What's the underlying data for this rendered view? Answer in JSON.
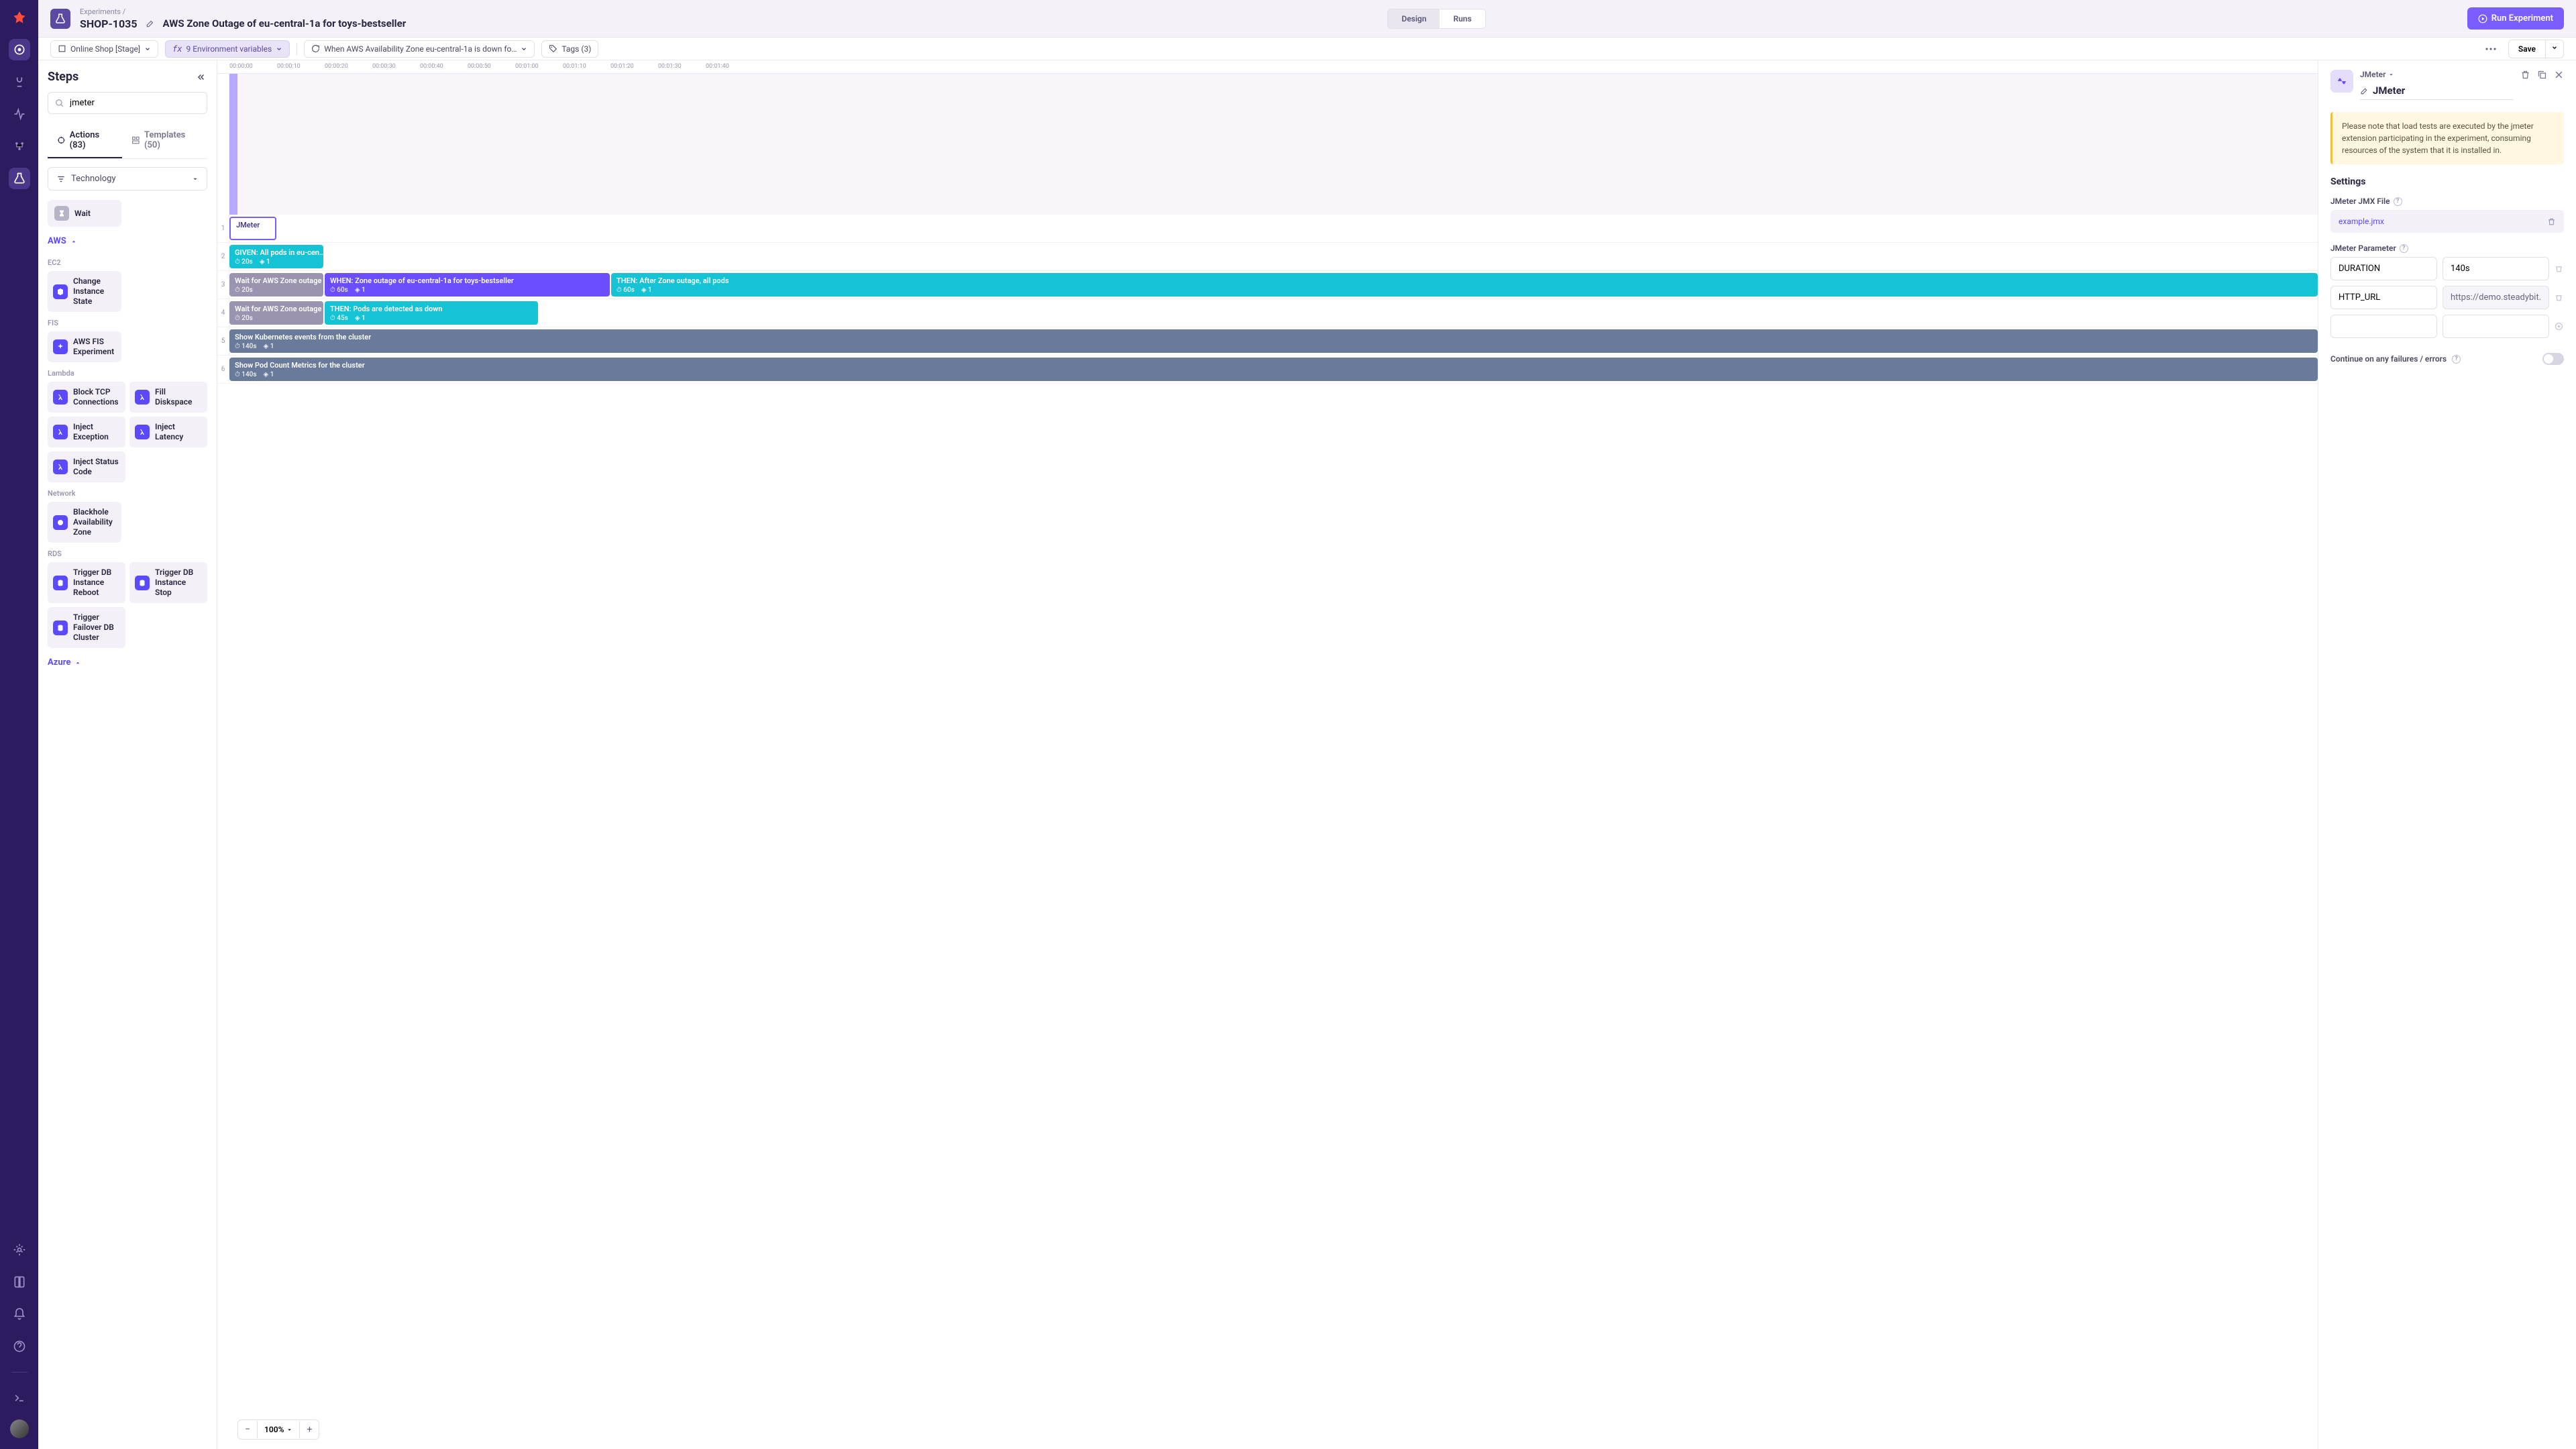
{
  "header": {
    "breadcrumb": "Experiments /",
    "code": "SHOP-1035",
    "title": "AWS Zone Outage of eu-central-1a for toys-bestseller",
    "tab_design": "Design",
    "tab_runs": "Runs",
    "run_button": "Run Experiment"
  },
  "toolbar": {
    "env": "Online Shop [Stage]",
    "vars": "9 Environment variables",
    "hypothesis": "When AWS Availability Zone eu-central-1a is down fo…",
    "tags": "Tags (3)",
    "save": "Save"
  },
  "sidebar": {
    "title": "Steps",
    "search_value": "jmeter",
    "tab_actions": "Actions (83)",
    "tab_templates": "Templates (50)",
    "tech_label": "Technology",
    "wait_label": "Wait",
    "cat_aws": "AWS",
    "sub_ec2": "EC2",
    "a_change_state": "Change Instance State",
    "sub_fis": "FIS",
    "a_fis": "AWS FIS Experiment",
    "sub_lambda": "Lambda",
    "a_block_tcp": "Block TCP Connections",
    "a_fill_disk": "Fill Diskspace",
    "a_inject_exc": "Inject Exception",
    "a_inject_lat": "Inject Latency",
    "a_inject_status": "Inject Status Code",
    "sub_network": "Network",
    "a_blackhole": "Blackhole Availability Zone",
    "sub_rds": "RDS",
    "a_db_reboot": "Trigger DB Instance Reboot",
    "a_db_stop": "Trigger DB Instance Stop",
    "a_failover": "Trigger Failover DB Cluster",
    "cat_azure": "Azure"
  },
  "ruler": [
    "00:00:00",
    "00:00:10",
    "00:00:20",
    "00:00:30",
    "00:00:40",
    "00:00:50",
    "00:01:00",
    "00:01:10",
    "00:01:20",
    "00:01:30",
    "00:01:40"
  ],
  "lanes": {
    "l1": {
      "jmeter": "JMeter"
    },
    "l2": {
      "given": "GIVEN: All pods in eu-cen…",
      "given_d": "20s",
      "given_t": "1"
    },
    "l3": {
      "wait": "Wait for AWS Zone outage",
      "wait_d": "20s",
      "when": "WHEN: Zone outage of eu-central-1a for toys-bestseller",
      "when_d": "60s",
      "when_t": "1",
      "then": "THEN: After Zone outage, all pods",
      "then_d": "60s",
      "then_t": "1"
    },
    "l4": {
      "wait": "Wait for AWS Zone outage",
      "wait_d": "20s",
      "then": "THEN: Pods are detected as down",
      "then_d": "45s",
      "then_t": "1"
    },
    "l5": {
      "title": "Show Kubernetes events from the cluster",
      "d": "140s",
      "t": "1"
    },
    "l6": {
      "title": "Show Pod Count Metrics for the cluster",
      "d": "140s",
      "t": "1"
    }
  },
  "zoom": "100%",
  "detail": {
    "crumb": "JMeter",
    "name": "JMeter",
    "note": "Please note that load tests are executed by the jmeter extension participating in the experiment, consuming resources of the system that it is installed in.",
    "settings": "Settings",
    "file_label": "JMeter JMX File",
    "file_name": "example.jmx",
    "param_label": "JMeter Parameter",
    "p1_k": "DURATION",
    "p1_v": "140s",
    "p2_k": "HTTP_URL",
    "p2_v": "https://demo.steadybit.io/prod",
    "continue": "Continue on any failures / errors"
  }
}
